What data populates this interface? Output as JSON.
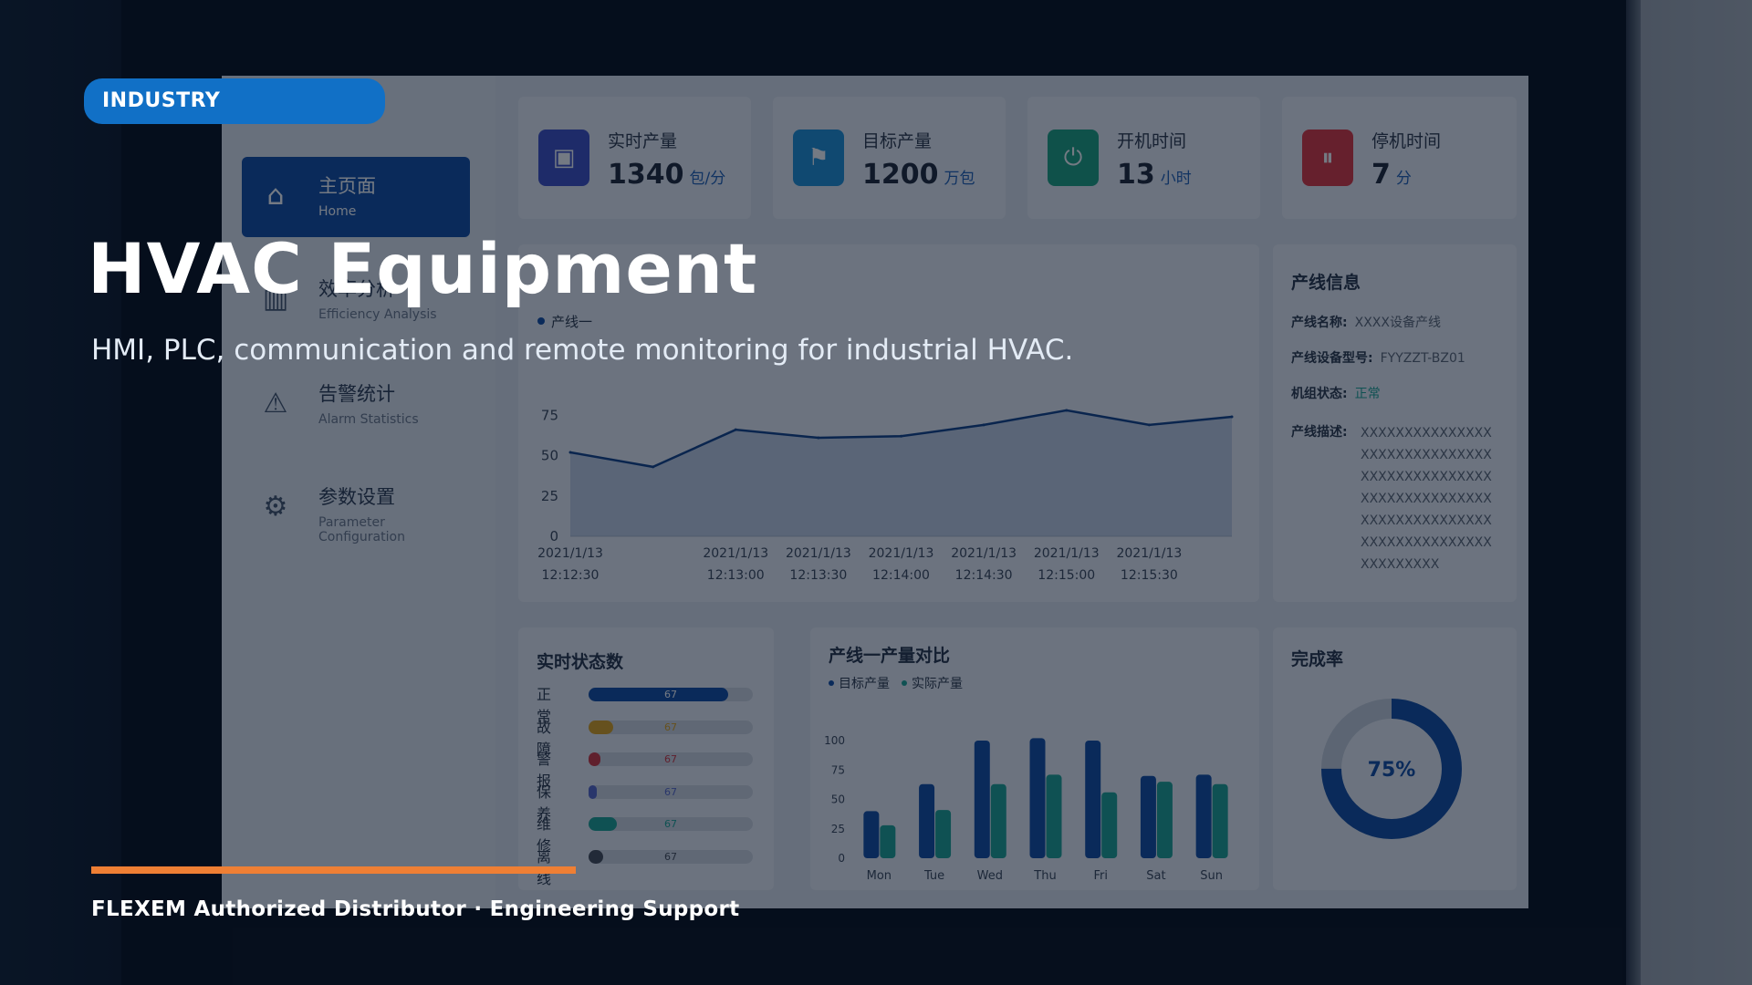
{
  "hero": {
    "badge": "INDUSTRY",
    "title": "HVAC Equipment",
    "subtitle": "HMI, PLC, communication and remote monitoring for industrial HVAC.",
    "footer": "FLEXEM Authorized Distributor · Engineering Support"
  },
  "colors": {
    "badge": "#1170c6",
    "accent_line": "#ef7f34",
    "primary_blue": "#0e4aa3",
    "teal": "#1aa391"
  },
  "sidebar": {
    "items": [
      {
        "title": "主页面",
        "subtitle": "Home",
        "icon": "home-icon",
        "active": true
      },
      {
        "title": "效率分析",
        "subtitle": "Efficiency Analysis",
        "icon": "bar-chart-icon",
        "active": false
      },
      {
        "title": "告警统计",
        "subtitle": "Alarm Statistics",
        "icon": "alarm-icon",
        "active": false
      },
      {
        "title": "参数设置",
        "subtitle": "Parameter Configuration",
        "icon": "gear-icon",
        "active": false
      }
    ]
  },
  "kpis": [
    {
      "label": "实时产量",
      "value": "1340",
      "unit": "包/分",
      "icon": "package-icon",
      "color": "#3b4cc4"
    },
    {
      "label": "目标产量",
      "value": "1200",
      "unit": "万包",
      "icon": "flag-icon",
      "color": "#1d8fd6"
    },
    {
      "label": "开机时间",
      "value": "13",
      "unit": "小时",
      "icon": "power-icon",
      "color": "#1aa37e"
    },
    {
      "label": "停机时间",
      "value": "7",
      "unit": "分",
      "icon": "pause-icon",
      "color": "#e0333d"
    }
  ],
  "line_info": {
    "title": "产线信息",
    "rows": [
      {
        "key": "产线名称:",
        "value": "XXXX设备产线"
      },
      {
        "key": "产线设备型号:",
        "value": "FYYZZT-BZ01"
      },
      {
        "key": "机组状态:",
        "value": "正常"
      }
    ],
    "desc_key": "产线描述:",
    "desc_value": "XXXXXXXXXXXXXXXXXXXXXXXXXXXXXXXXXXXXXXXXXXXXXXXXXXXXXXXXXXXXXXXXXXXXXXXXXXXXXXXXXXXXXXXXXXXXXXXXXXX"
  },
  "status": {
    "title": "实时状态数",
    "rows": [
      {
        "label": "正常",
        "value": "67",
        "fill": 0.85,
        "color": "#0e4aa3"
      },
      {
        "label": "故障",
        "value": "67",
        "fill": 0.15,
        "color": "#e0a21a"
      },
      {
        "label": "警报",
        "value": "67",
        "fill": 0.07,
        "color": "#d2333d"
      },
      {
        "label": "保养",
        "value": "67",
        "fill": 0.05,
        "color": "#5565c8"
      },
      {
        "label": "维修",
        "value": "67",
        "fill": 0.17,
        "color": "#1aa391"
      },
      {
        "label": "离线",
        "value": "67",
        "fill": 0.09,
        "color": "#444a55"
      }
    ]
  },
  "completion": {
    "title": "完成率",
    "label": "75%",
    "value": 0.75
  },
  "chart_data": [
    {
      "type": "area",
      "series": [
        {
          "name": "产线一",
          "values": [
            52,
            43,
            66,
            61,
            62,
            69,
            78,
            69,
            74
          ]
        }
      ],
      "x": [
        "2021/1/13 12:12:30",
        "",
        "2021/1/13 12:13:00",
        "2021/1/13 12:13:30",
        "2021/1/13 12:14:00",
        "2021/1/13 12:14:30",
        "2021/1/13 12:15:00",
        "2021/1/13 12:15:30",
        ""
      ],
      "ticks": [
        "0",
        "25",
        "50",
        "75"
      ],
      "ylim": [
        0,
        100
      ]
    },
    {
      "type": "bar",
      "title": "产线一产量对比",
      "categories": [
        "Mon",
        "Tue",
        "Wed",
        "Thu",
        "Fri",
        "Sat",
        "Sun"
      ],
      "series": [
        {
          "name": "目标产量",
          "values": [
            40,
            63,
            100,
            102,
            100,
            70,
            71
          ],
          "color": "#0e4aa3"
        },
        {
          "name": "实际产量",
          "values": [
            28,
            41,
            63,
            71,
            56,
            65,
            63
          ],
          "color": "#1aa391"
        }
      ],
      "ticks": [
        "0",
        "25",
        "50",
        "75",
        "100"
      ],
      "ylim": [
        0,
        100
      ]
    }
  ]
}
